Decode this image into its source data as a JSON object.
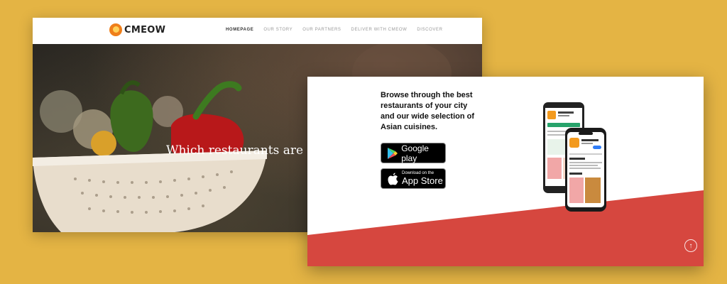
{
  "site": {
    "logo_text": "CMEOW",
    "nav": [
      {
        "label": "HOMEPAGE",
        "active": true
      },
      {
        "label": "OUR STORY",
        "active": false
      },
      {
        "label": "OUR PARTNERS",
        "active": false
      },
      {
        "label": "DELIVER WITH CMEOW",
        "active": false
      },
      {
        "label": "DISCOVER",
        "active": false
      }
    ],
    "hero_text": "Which restaurants are n"
  },
  "app_section": {
    "tagline": "Browse through the best restaurants of your city and our wide selection of Asian cuisines.",
    "google_play": {
      "label": "Google play"
    },
    "app_store": {
      "small": "Download on the",
      "big": "App Store"
    }
  },
  "colors": {
    "page_background": "#e4b444",
    "accent_red": "#d6473f",
    "logo_orange": "#ef7f1a"
  },
  "icons": [
    "cmeow-logo-icon",
    "google-play-icon",
    "apple-icon",
    "arrow-up-icon"
  ]
}
